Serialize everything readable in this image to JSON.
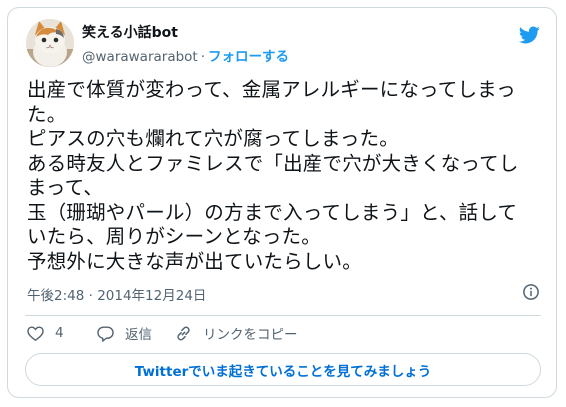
{
  "author": {
    "name": "笑える小話bot",
    "handle": "@warawararabot",
    "separator": "·",
    "follow_label": "フォローする"
  },
  "tweet": {
    "lines": [
      "出産で体質が変わって、金属アレルギーになってしまっ",
      "た。",
      "ピアスの穴も爛れて穴が腐ってしまった。",
      "ある時友人とファミレスで「出産で穴が大きくなってし",
      "まって、",
      "玉（珊瑚やパール）の方まで入ってしまう」と、話して",
      "いたら、周りがシーンとなった。",
      "予想外に大きな声が出ていたらしい。"
    ],
    "timestamp": "午後2:48 · 2014年12月24日"
  },
  "actions": {
    "like_count": "4",
    "reply_label": "返信",
    "copy_link_label": "リンクをコピー"
  },
  "cta_label": "Twitterでいま起きていることを見てみましょう",
  "colors": {
    "accent": "#1d9bf0",
    "like": "#f91880",
    "text": "#0f1419",
    "secondary": "#536471",
    "border": "#cfd9de",
    "cta_text": "#006fd6"
  },
  "icons": [
    "avatar-cat-photo",
    "twitter-bird-icon",
    "info-icon",
    "heart-icon",
    "reply-icon",
    "link-icon"
  ]
}
